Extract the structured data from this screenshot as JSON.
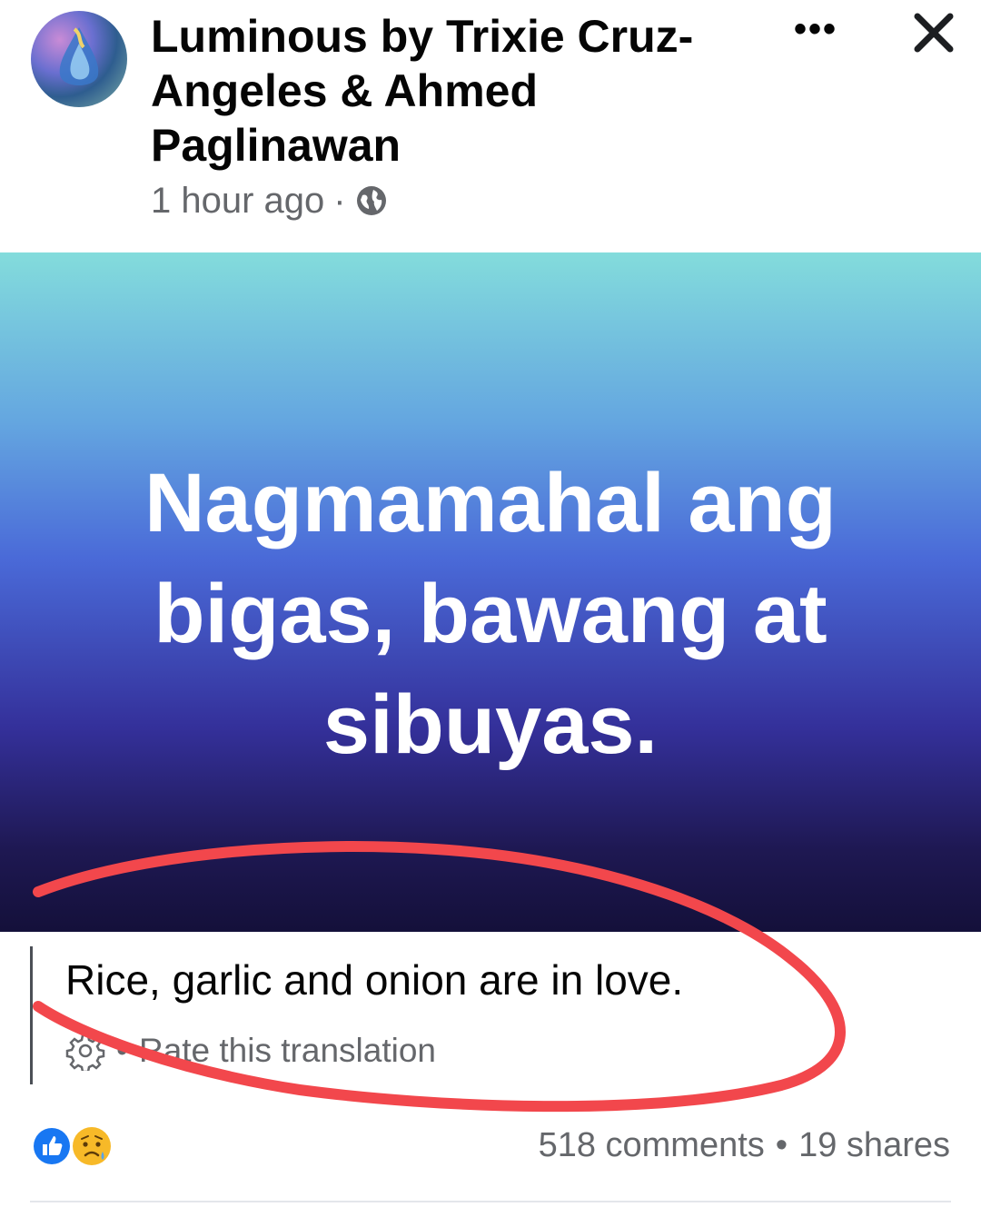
{
  "post": {
    "page_name": "Luminous by Trixie Cruz-Angeles & Ahmed Paglinawan",
    "timestamp": "1 hour ago",
    "separator": "·",
    "privacy_icon": "globe-icon",
    "more_label": "•••",
    "close_icon": "close-icon"
  },
  "banner": {
    "text": "Nagmamahal ang bigas, bawang at sibuyas.",
    "gradient_colors": [
      "#83dcdc",
      "#4a6ad8",
      "#14103a"
    ]
  },
  "translation": {
    "text": "Rice, garlic and onion are in love.",
    "settings_icon": "gear-icon",
    "bullet": "•",
    "rate_label": "Rate this translation"
  },
  "footer": {
    "reaction_icons": [
      "like-icon",
      "sad-icon"
    ],
    "comments": "518 comments",
    "separator": "•",
    "shares": "19 shares"
  },
  "colors": {
    "annotation_stroke": "#f2474c",
    "like_blue": "#1877f2",
    "sad_yellow": "#f7b928"
  }
}
